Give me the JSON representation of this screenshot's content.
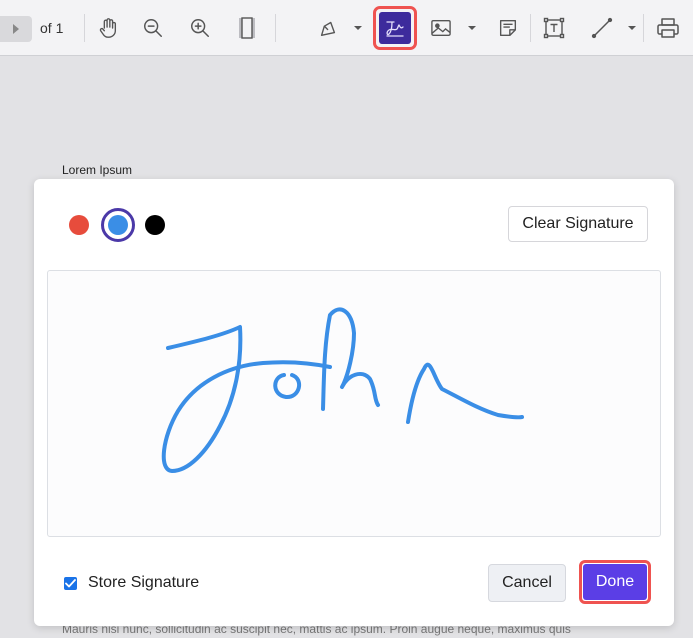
{
  "toolbar": {
    "page_of": "of 1",
    "icons": [
      "page-next-icon",
      "hand-icon",
      "zoom-out-icon",
      "zoom-in-icon",
      "fit-page-icon",
      "highlight-pen-icon",
      "signature-icon",
      "image-icon",
      "note-icon",
      "text-box-icon",
      "line-icon",
      "print-icon"
    ]
  },
  "document": {
    "heading": "Lorem Ipsum",
    "footer_text": "Mauris nisi nunc, sollicitudin ac suscipit nec, mattis ac ipsum. Proin augue neque, maximus quis"
  },
  "signature_modal": {
    "colors": [
      {
        "name": "red",
        "hex": "#e74c3c",
        "selected": false
      },
      {
        "name": "blue",
        "hex": "#3a8ee6",
        "selected": true
      },
      {
        "name": "black",
        "hex": "#000000",
        "selected": false
      }
    ],
    "clear_label": "Clear Signature",
    "store_label": "Store Signature",
    "store_checked": true,
    "cancel_label": "Cancel",
    "done_label": "Done",
    "stroke_color": "#3a8ee6"
  },
  "colors": {
    "accent": "#5b3ee6",
    "highlight": "#ef5350",
    "toolbar_active": "#3d2b9c"
  }
}
